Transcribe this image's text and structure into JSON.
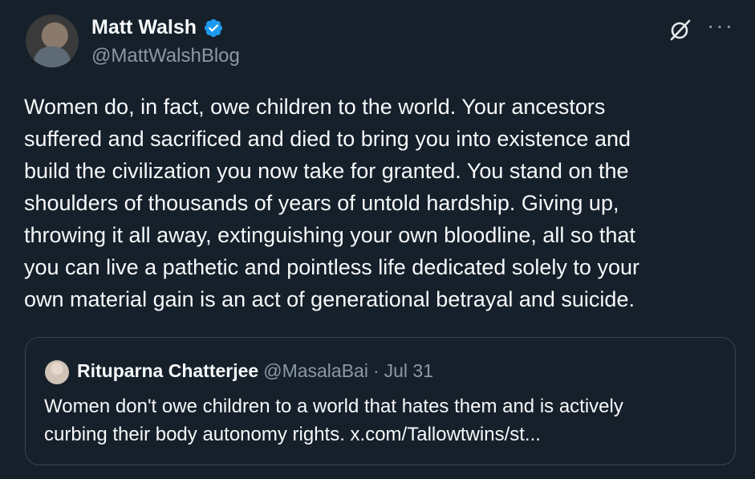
{
  "author": {
    "name": "Matt Walsh",
    "handle": "@MattWalshBlog",
    "verified": true,
    "verified_color": "#1d9bf0"
  },
  "icons": {
    "verified": "verified-badge-icon",
    "grok": "grok-icon",
    "more": "more-options-icon"
  },
  "tweet": {
    "text": "Women do, in fact, owe children to the world. Your ancestors\nsuffered and sacrificed and died to bring you into existence and\nbuild the civilization you now take for granted. You stand on the\nshoulders of thousands of years of untold hardship. Giving up,\nthrowing it all away, extinguishing your own bloodline, all so that\nyou can live a pathetic and pointless life dedicated solely to your\nown material gain is an act of generational betrayal and suicide."
  },
  "quote": {
    "name": "Rituparna Chatterjee",
    "handle": "@MasalaBai",
    "separator": "·",
    "date": "Jul 31",
    "text_line1": "Women don't owe children to a world that hates them and is actively",
    "text_line2": "curbing their body autonomy rights. x.com/Tallowtwins/st..."
  },
  "colors": {
    "background": "#15202b",
    "text_primary": "#f7f9f9",
    "text_secondary": "#8b98a5",
    "border": "#38444d"
  }
}
